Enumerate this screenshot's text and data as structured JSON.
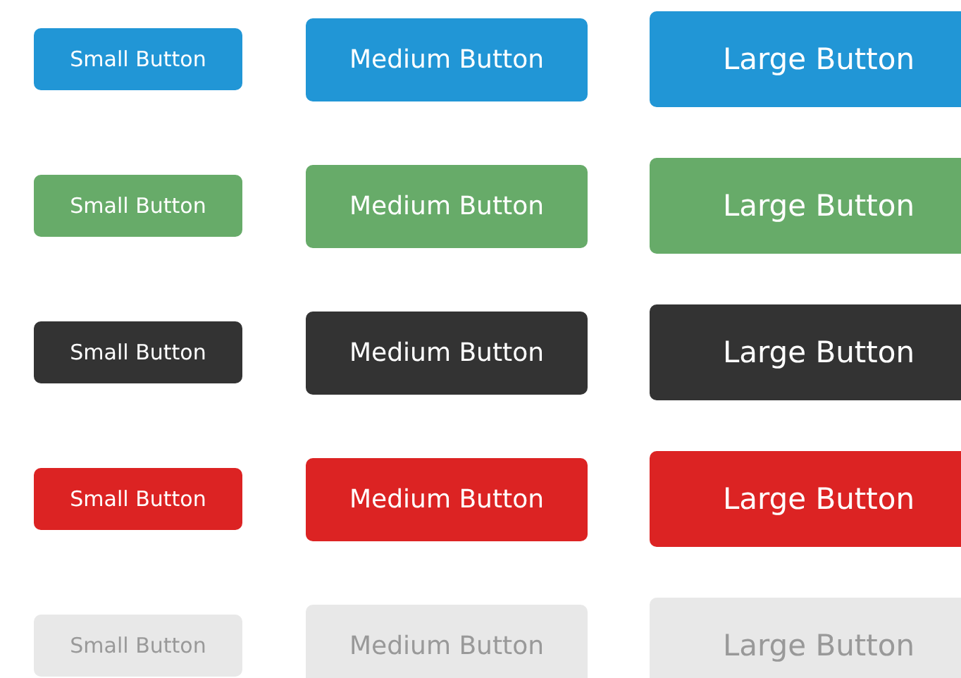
{
  "rows": [
    {
      "kind": "primary",
      "buttons": [
        {
          "label": "Small Button",
          "kind": "small"
        },
        {
          "label": "Medium Button",
          "kind": "medium"
        },
        {
          "label": "Large Button",
          "kind": "large"
        }
      ]
    },
    {
      "kind": "success",
      "buttons": [
        {
          "label": "Small Button",
          "kind": "small"
        },
        {
          "label": "Medium Button",
          "kind": "medium"
        },
        {
          "label": "Large Button",
          "kind": "large"
        }
      ]
    },
    {
      "kind": "dark",
      "buttons": [
        {
          "label": "Small Button",
          "kind": "small"
        },
        {
          "label": "Medium Button",
          "kind": "medium"
        },
        {
          "label": "Large Button",
          "kind": "large"
        }
      ]
    },
    {
      "kind": "danger",
      "buttons": [
        {
          "label": "Small Button",
          "kind": "small"
        },
        {
          "label": "Medium Button",
          "kind": "medium"
        },
        {
          "label": "Large Button",
          "kind": "large"
        }
      ]
    },
    {
      "kind": "light",
      "buttons": [
        {
          "label": "Small Button",
          "kind": "small"
        },
        {
          "label": "Medium Button",
          "kind": "medium"
        },
        {
          "label": "Large Button",
          "kind": "large"
        }
      ]
    }
  ]
}
